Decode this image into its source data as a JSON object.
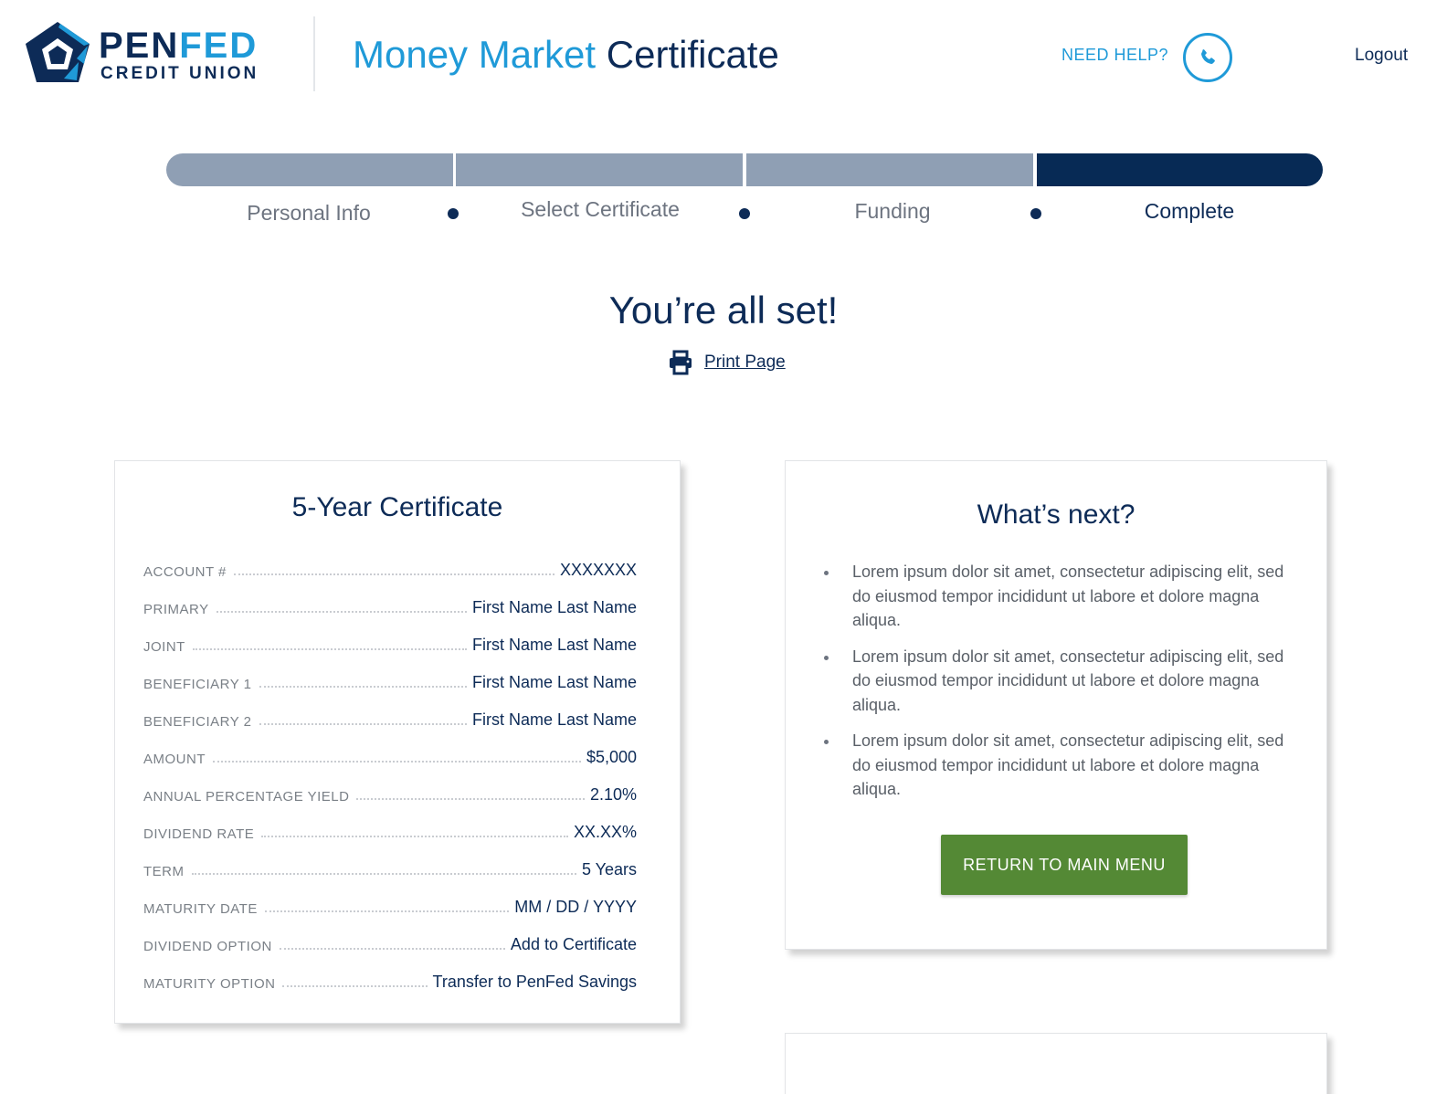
{
  "brand": {
    "name_part1": "PEN",
    "name_part2": "FED",
    "subtitle": "CREDIT UNION",
    "logo_icon": "pentagon-logo-icon"
  },
  "header": {
    "title_part1": "Money Market",
    "title_part2": "Certificate",
    "need_help": "NEED HELP?",
    "phone_icon": "phone-icon",
    "logout": "Logout"
  },
  "progress": {
    "steps": [
      {
        "label": "Personal Info",
        "status": "complete"
      },
      {
        "label": "Select Certificate",
        "status": "complete"
      },
      {
        "label": "Funding",
        "status": "complete"
      },
      {
        "label": "Complete",
        "status": "current"
      }
    ]
  },
  "hero": {
    "title": "You’re all set!",
    "print_label": "Print Page",
    "print_icon": "printer-icon"
  },
  "certificate": {
    "title": "5-Year Certificate",
    "rows": [
      {
        "key": "ACCOUNT #",
        "value": "XXXXXXX"
      },
      {
        "key": "PRIMARY",
        "value": "First Name Last Name"
      },
      {
        "key": "JOINT",
        "value": "First Name Last Name"
      },
      {
        "key": "BENEFICIARY 1",
        "value": "First Name Last Name"
      },
      {
        "key": "BENEFICIARY 2",
        "value": "First Name Last Name"
      },
      {
        "key": "AMOUNT",
        "value": "$5,000"
      },
      {
        "key": "ANNUAL PERCENTAGE YIELD",
        "value": "2.10%"
      },
      {
        "key": "DIVIDEND RATE",
        "value": "XX.XX%"
      },
      {
        "key": "TERM",
        "value": "5 Years"
      },
      {
        "key": "MATURITY DATE",
        "value": "MM / DD / YYYY"
      },
      {
        "key": "DIVIDEND OPTION",
        "value": "Add to Certificate"
      },
      {
        "key": "MATURITY OPTION",
        "value": "Transfer to PenFed Savings"
      }
    ]
  },
  "next": {
    "title": "What’s next?",
    "items": [
      "Lorem ipsum dolor sit amet, consectetur adipiscing elit, sed do eiusmod tempor incididunt ut labore et dolore magna aliqua.",
      "Lorem ipsum dolor sit amet, consectetur adipiscing elit, sed do eiusmod tempor incididunt ut labore et dolore magna aliqua.",
      "Lorem ipsum dolor sit amet, consectetur adipiscing elit, sed do eiusmod tempor incididunt ut labore et dolore magna aliqua."
    ],
    "button": "RETURN TO MAIN MENU"
  },
  "colors": {
    "navy": "#0d2b57",
    "blue": "#1f9ad8",
    "progress_done": "#8f9fb4",
    "progress_active": "#072a55",
    "button_green": "#548935"
  }
}
